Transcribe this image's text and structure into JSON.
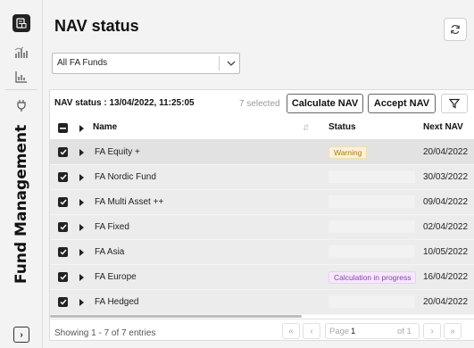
{
  "rail": {
    "icons": [
      "app-icon",
      "funds-chart-icon",
      "bar-chart-icon",
      "plug-icon"
    ],
    "title": "Fund Management",
    "expand_icon": "expand-icon"
  },
  "header": {
    "title": "NAV status",
    "refresh_icon": "refresh-icon"
  },
  "fund_select": {
    "value": "All FA Funds"
  },
  "toolbar": {
    "status_label": "NAV status : 13/04/2022, 11:25:05",
    "selected": "7 selected",
    "calculate_label": "Calculate NAV",
    "accept_label": "Accept NAV",
    "filter_icon": "filter-icon"
  },
  "table": {
    "columns": {
      "name": "Name",
      "status": "Status",
      "next_nav": "Next NAV"
    },
    "rows": [
      {
        "name": "FA Equity +",
        "status": "Warning",
        "status_type": "warning",
        "next_nav": "20/04/2022"
      },
      {
        "name": "FA Nordic Fund",
        "status": "",
        "status_type": "",
        "next_nav": "30/03/2022"
      },
      {
        "name": "FA Multi Asset ++",
        "status": "",
        "status_type": "",
        "next_nav": "09/04/2022"
      },
      {
        "name": "FA Fixed",
        "status": "",
        "status_type": "",
        "next_nav": "02/04/2022"
      },
      {
        "name": "FA Asia",
        "status": "",
        "status_type": "",
        "next_nav": "10/05/2022"
      },
      {
        "name": "FA Europe",
        "status": "Calculation in progress",
        "status_type": "progress",
        "next_nav": "16/04/2022"
      },
      {
        "name": "FA Hedged",
        "status": "",
        "status_type": "",
        "next_nav": "20/04/2022"
      }
    ]
  },
  "footer": {
    "showing": "Showing 1 - 7 of 7 entries",
    "page_label": "Page",
    "page_value": "1",
    "page_of": "of 1",
    "first_icon": "«",
    "prev_icon": "‹",
    "next_icon": "›",
    "last_icon": "»"
  },
  "colors": {
    "warning_bg": "#fbf1d7",
    "warning_text": "#a87b16",
    "progress_bg": "#f5e9fb",
    "progress_text": "#8a3fb0"
  }
}
